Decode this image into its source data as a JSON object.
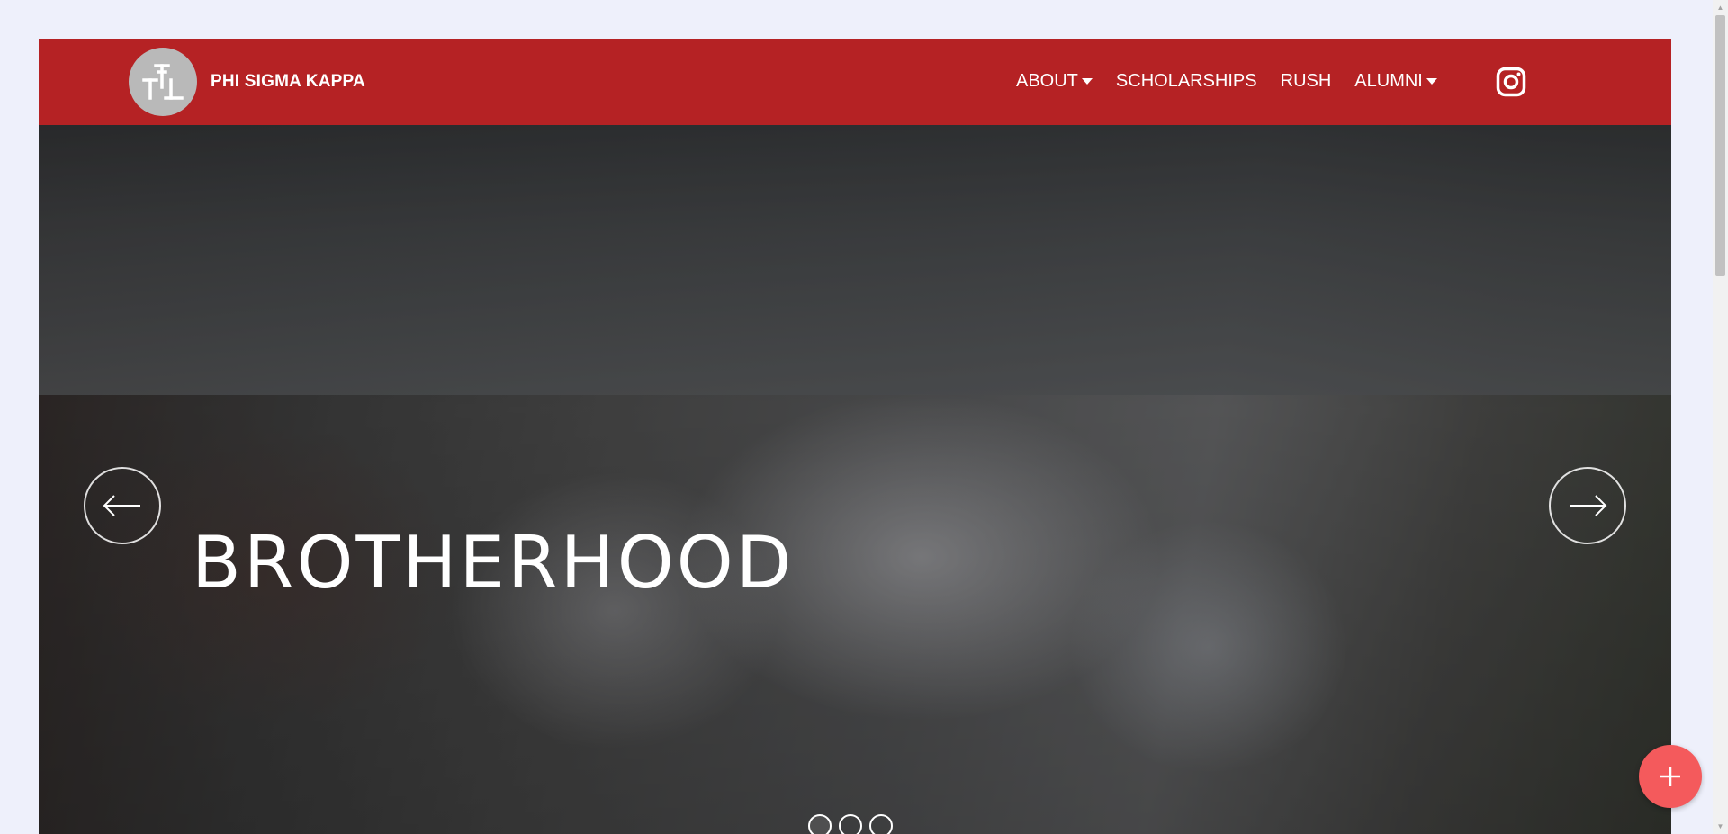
{
  "header": {
    "brand": "PHI SIGMA KAPPA",
    "logo_icon": "greek-letters-logo",
    "nav": [
      {
        "label": "ABOUT",
        "dropdown": true
      },
      {
        "label": "SCHOLARSHIPS",
        "dropdown": false
      },
      {
        "label": "RUSH",
        "dropdown": false
      },
      {
        "label": "ALUMNI",
        "dropdown": true
      }
    ],
    "social_icon": "instagram-icon",
    "background_color": "#b52224"
  },
  "hero": {
    "title": "BROTHERHOOD",
    "slide_count": 3,
    "active_slide": 1,
    "prev_icon": "arrow-left-icon",
    "next_icon": "arrow-right-icon"
  },
  "fab": {
    "icon": "plus-icon",
    "color": "#f45a5c"
  },
  "page": {
    "background_color": "#eef0fb"
  }
}
